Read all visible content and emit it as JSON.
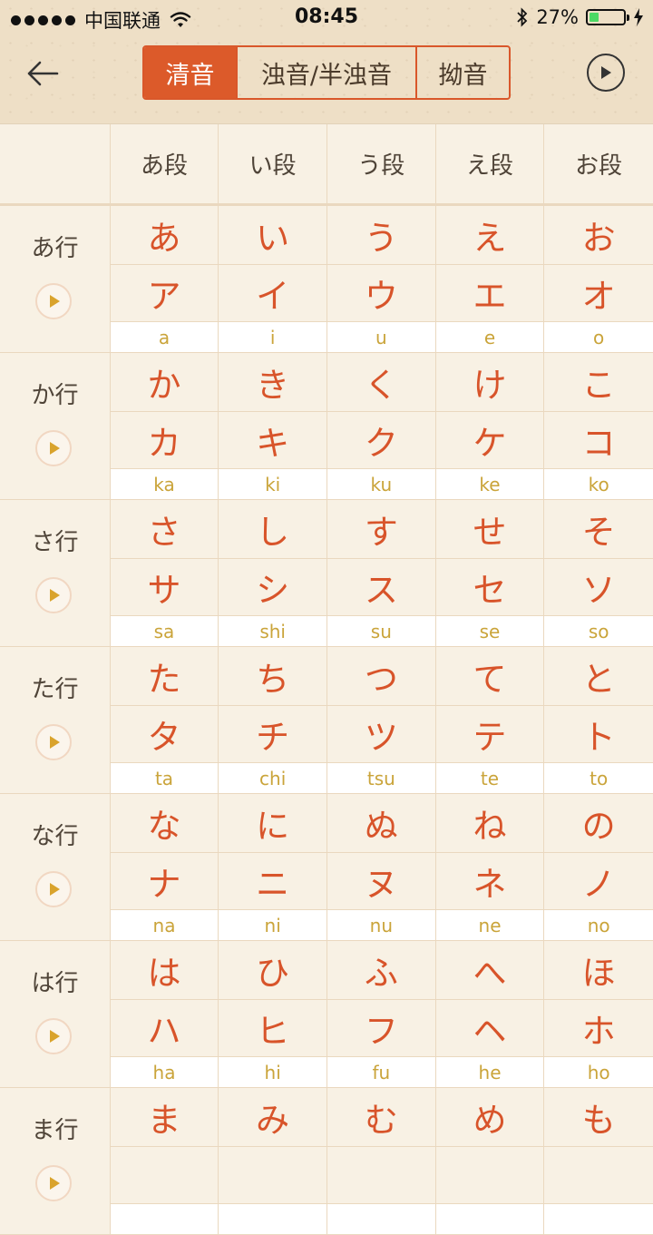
{
  "status": {
    "carrier": "中国联通",
    "time": "08:45",
    "battery": "27%",
    "battery_level": 0.27,
    "battery_color": "#4cd964"
  },
  "nav": {
    "back_icon": "arrow-left-icon",
    "play_all_icon": "play-circle-icon",
    "tabs": [
      {
        "label": "清音",
        "active": true
      },
      {
        "label": "浊音/半浊音",
        "active": false
      },
      {
        "label": "拗音",
        "active": false
      }
    ],
    "accent": "#dc5a2a"
  },
  "table": {
    "columns": [
      "あ段",
      "い段",
      "う段",
      "え段",
      "お段"
    ],
    "rows": [
      {
        "label": "あ行",
        "cells": [
          {
            "hira": "あ",
            "kata": "ア",
            "roma": "a"
          },
          {
            "hira": "い",
            "kata": "イ",
            "roma": "i"
          },
          {
            "hira": "う",
            "kata": "ウ",
            "roma": "u"
          },
          {
            "hira": "え",
            "kata": "エ",
            "roma": "e"
          },
          {
            "hira": "お",
            "kata": "オ",
            "roma": "o"
          }
        ]
      },
      {
        "label": "か行",
        "cells": [
          {
            "hira": "か",
            "kata": "カ",
            "roma": "ka"
          },
          {
            "hira": "き",
            "kata": "キ",
            "roma": "ki"
          },
          {
            "hira": "く",
            "kata": "ク",
            "roma": "ku"
          },
          {
            "hira": "け",
            "kata": "ケ",
            "roma": "ke"
          },
          {
            "hira": "こ",
            "kata": "コ",
            "roma": "ko"
          }
        ]
      },
      {
        "label": "さ行",
        "cells": [
          {
            "hira": "さ",
            "kata": "サ",
            "roma": "sa"
          },
          {
            "hira": "し",
            "kata": "シ",
            "roma": "shi"
          },
          {
            "hira": "す",
            "kata": "ス",
            "roma": "su"
          },
          {
            "hira": "せ",
            "kata": "セ",
            "roma": "se"
          },
          {
            "hira": "そ",
            "kata": "ソ",
            "roma": "so"
          }
        ]
      },
      {
        "label": "た行",
        "cells": [
          {
            "hira": "た",
            "kata": "タ",
            "roma": "ta"
          },
          {
            "hira": "ち",
            "kata": "チ",
            "roma": "chi"
          },
          {
            "hira": "つ",
            "kata": "ツ",
            "roma": "tsu"
          },
          {
            "hira": "て",
            "kata": "テ",
            "roma": "te"
          },
          {
            "hira": "と",
            "kata": "ト",
            "roma": "to"
          }
        ]
      },
      {
        "label": "な行",
        "cells": [
          {
            "hira": "な",
            "kata": "ナ",
            "roma": "na"
          },
          {
            "hira": "に",
            "kata": "ニ",
            "roma": "ni"
          },
          {
            "hira": "ぬ",
            "kata": "ヌ",
            "roma": "nu"
          },
          {
            "hira": "ね",
            "kata": "ネ",
            "roma": "ne"
          },
          {
            "hira": "の",
            "kata": "ノ",
            "roma": "no"
          }
        ]
      },
      {
        "label": "は行",
        "cells": [
          {
            "hira": "は",
            "kata": "ハ",
            "roma": "ha"
          },
          {
            "hira": "ひ",
            "kata": "ヒ",
            "roma": "hi"
          },
          {
            "hira": "ふ",
            "kata": "フ",
            "roma": "fu"
          },
          {
            "hira": "へ",
            "kata": "ヘ",
            "roma": "he"
          },
          {
            "hira": "ほ",
            "kata": "ホ",
            "roma": "ho"
          }
        ]
      },
      {
        "label": "ま行",
        "cells": [
          {
            "hira": "ま",
            "kata": "",
            "roma": ""
          },
          {
            "hira": "み",
            "kata": "",
            "roma": ""
          },
          {
            "hira": "む",
            "kata": "",
            "roma": ""
          },
          {
            "hira": "め",
            "kata": "",
            "roma": ""
          },
          {
            "hira": "も",
            "kata": "",
            "roma": ""
          }
        ]
      }
    ],
    "kana_color": "#d8542a",
    "romaji_color": "#caa43a",
    "play_icon": "play-icon"
  }
}
